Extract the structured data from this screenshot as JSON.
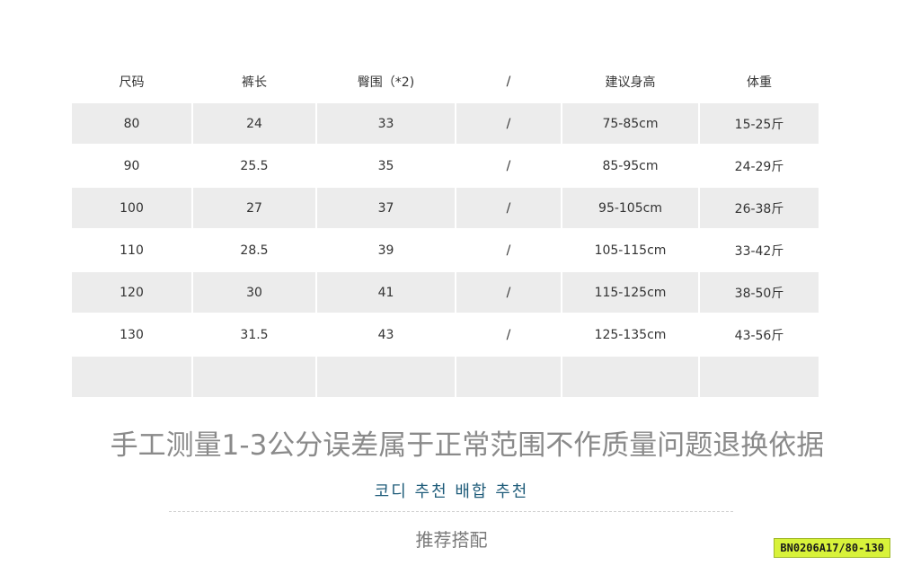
{
  "table": {
    "headers": [
      "尺码",
      "裤长",
      "臀围（*2)",
      "/",
      "建议身高",
      "体重"
    ],
    "rows": [
      [
        "80",
        "24",
        "33",
        "/",
        "75-85cm",
        "15-25斤"
      ],
      [
        "90",
        "25.5",
        "35",
        "/",
        "85-95cm",
        "24-29斤"
      ],
      [
        "100",
        "27",
        "37",
        "/",
        "95-105cm",
        "26-38斤"
      ],
      [
        "110",
        "28.5",
        "39",
        "/",
        "105-115cm",
        "33-42斤"
      ],
      [
        "120",
        "30",
        "41",
        "/",
        "115-125cm",
        "38-50斤"
      ],
      [
        "130",
        "31.5",
        "43",
        "/",
        "125-135cm",
        "43-56斤"
      ],
      [
        "",
        "",
        "",
        "",
        "",
        ""
      ]
    ]
  },
  "notice": "手工测量1-3公分误差属于正常范围不作质量问题退换依据",
  "subtitle_kr": "코디 추천 배합 추천",
  "subtitle_cn": "推荐搭配",
  "sku_badge": "BN0206A17/80-130",
  "colors": {
    "row_shade": "#ececec",
    "notice_text": "#8a8a8a",
    "kr_text": "#1f5c7a",
    "badge_bg": "#d8f23a"
  }
}
